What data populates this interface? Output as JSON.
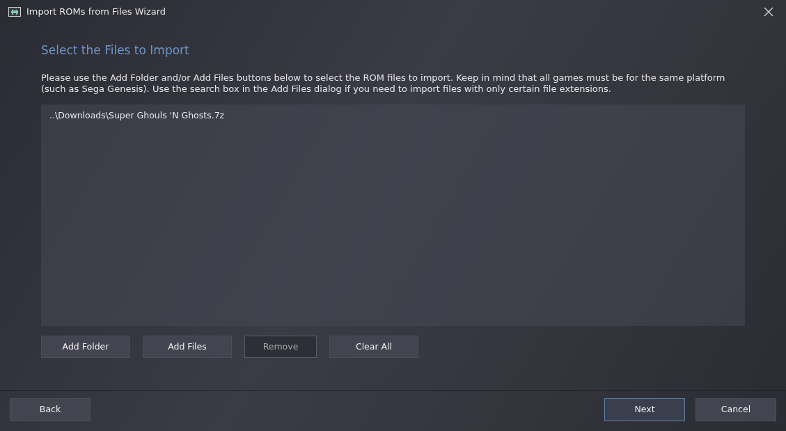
{
  "window": {
    "title": "Import ROMs from Files Wizard"
  },
  "heading": "Select the Files to Import",
  "instructions": "Please use the Add Folder and/or Add Files buttons below to select the ROM files to import. Keep in mind that all games must be for the same platform (such as Sega Genesis). Use the search box in the Add Files dialog if you need to import files with only certain file extensions.",
  "files": [
    {
      "path": "..\\Downloads\\Super Ghouls 'N Ghosts.7z",
      "selected": false
    }
  ],
  "list_buttons": [
    {
      "label": "Add Folder",
      "disabled": false
    },
    {
      "label": "Add Files",
      "disabled": false
    },
    {
      "label": "Remove",
      "disabled": true
    },
    {
      "label": "Clear All",
      "disabled": false
    }
  ],
  "nav_buttons_left": [
    {
      "label": "Back",
      "default": false
    }
  ],
  "nav_buttons_right": [
    {
      "label": "Next",
      "default": true
    },
    {
      "label": "Cancel",
      "default": false
    }
  ]
}
